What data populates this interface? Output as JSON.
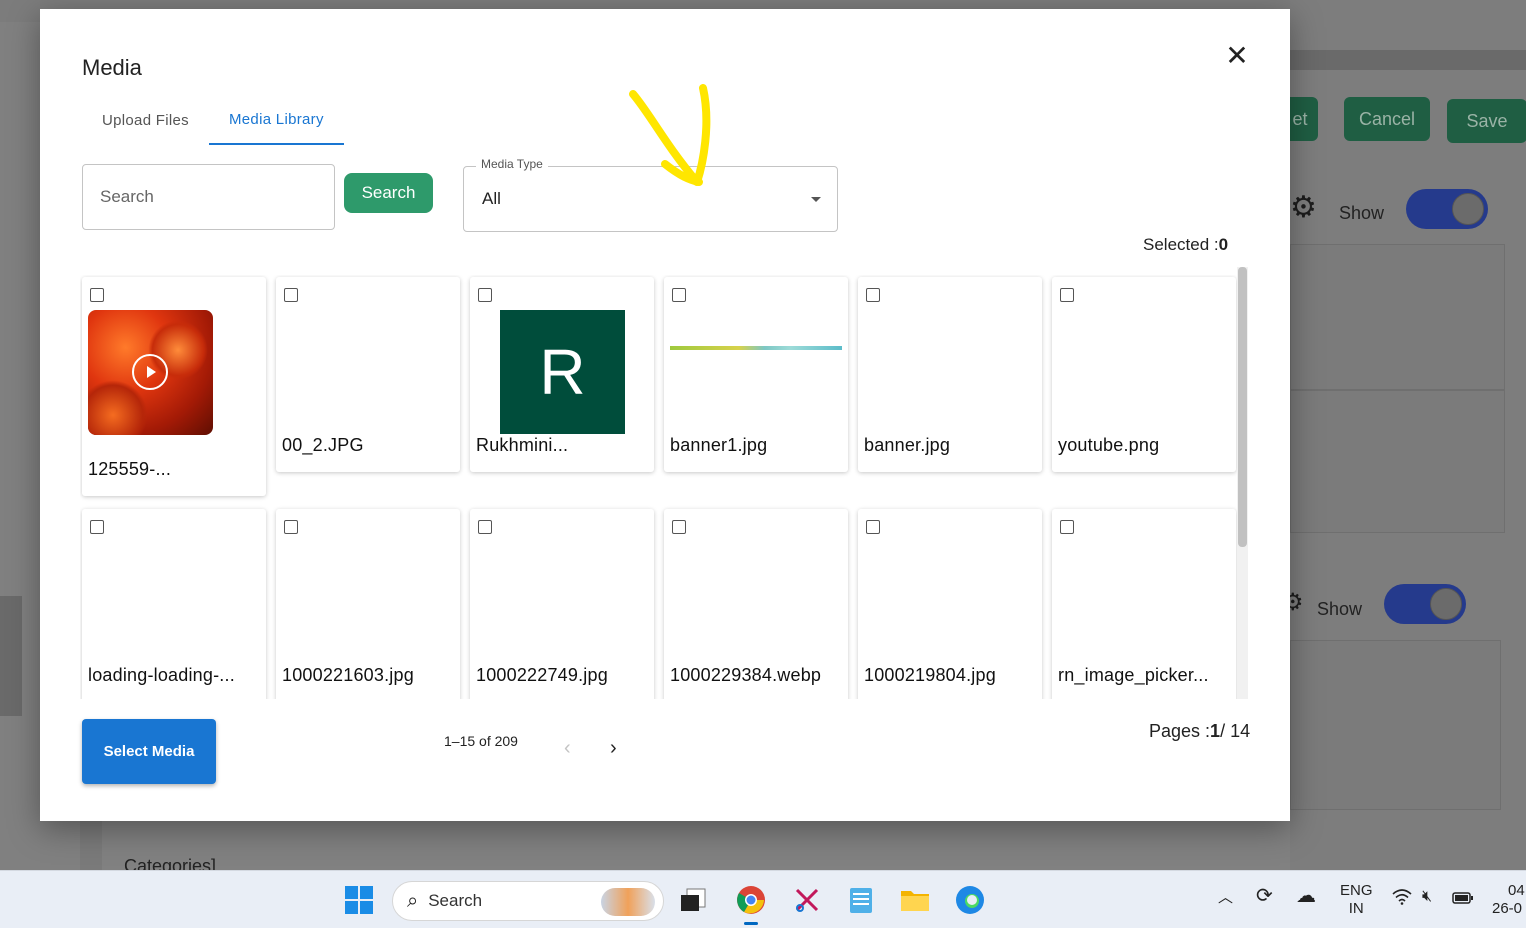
{
  "background": {
    "buttons": {
      "cut_label": "et",
      "cancel_label": "Cancel",
      "save_label": "Save"
    },
    "show_label_1": "Show",
    "show_label_2": "Show",
    "categories_label": "Categories]"
  },
  "modal": {
    "title": "Media",
    "close_icon": "close-icon",
    "tabs": [
      {
        "label": "Upload Files",
        "active": false
      },
      {
        "label": "Media Library",
        "active": true
      }
    ],
    "search": {
      "placeholder": "Search",
      "value": "",
      "button_label": "Search"
    },
    "media_type": {
      "label": "Media Type",
      "value": "All"
    },
    "selected": {
      "label": "Selected :",
      "count": "0"
    },
    "items": [
      {
        "name": "125559-...",
        "thumb": "video-tomato"
      },
      {
        "name": "00_2.JPG",
        "thumb": "none"
      },
      {
        "name": "Rukhmini...",
        "thumb": "letter-r"
      },
      {
        "name": "banner1.jpg",
        "thumb": "banner-strip"
      },
      {
        "name": "banner.jpg",
        "thumb": "none"
      },
      {
        "name": "youtube.png",
        "thumb": "none"
      },
      {
        "name": "loading-loading-...",
        "thumb": "none"
      },
      {
        "name": "1000221603.jpg",
        "thumb": "none"
      },
      {
        "name": "1000222749.jpg",
        "thumb": "none"
      },
      {
        "name": "1000229384.webp",
        "thumb": "none"
      },
      {
        "name": "1000219804.jpg",
        "thumb": "none"
      },
      {
        "name": "rn_image_picker...",
        "thumb": "none"
      }
    ],
    "thumb_letter": "R",
    "footer": {
      "select_button": "Select Media",
      "range": "1–15 of 209",
      "pages_label": "Pages :",
      "current_page": "1",
      "total_pages": "/ 14"
    }
  },
  "taskbar": {
    "search_label": "Search",
    "lang_top": "ENG",
    "lang_bottom": "IN",
    "time_top": "04",
    "time_bottom": "26-0",
    "icons": [
      "windows-start-icon",
      "search-icon",
      "task-view-icon",
      "chrome-icon",
      "snipping-tool-icon",
      "notepad-icon",
      "file-explorer-icon",
      "edge-icon",
      "chevron-up-icon",
      "sync-icon",
      "onedrive-icon",
      "wifi-icon",
      "mute-icon",
      "battery-icon"
    ]
  },
  "colors": {
    "accent": "#1976d2",
    "search_button": "#2e9a6b",
    "annotation": "#ffe600"
  }
}
